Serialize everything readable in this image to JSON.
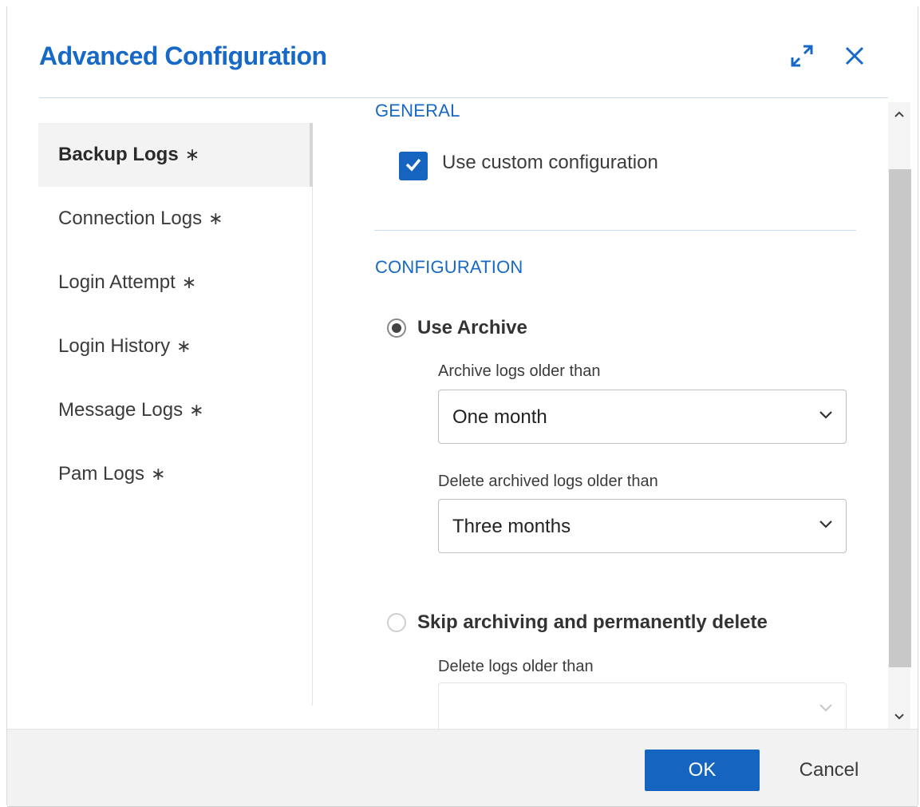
{
  "dialog": {
    "title": "Advanced Configuration",
    "icons": {
      "expand": "expand-icon",
      "close": "close-icon"
    },
    "accent_color": "#1769c7"
  },
  "sidebar": {
    "items": [
      {
        "label": "Backup Logs",
        "marker": "∗",
        "active": true
      },
      {
        "label": "Connection Logs",
        "marker": "∗",
        "active": false
      },
      {
        "label": "Login Attempt",
        "marker": "∗",
        "active": false
      },
      {
        "label": "Login History",
        "marker": "∗",
        "active": false
      },
      {
        "label": "Message Logs",
        "marker": "∗",
        "active": false
      },
      {
        "label": "Pam Logs",
        "marker": "∗",
        "active": false
      }
    ]
  },
  "general": {
    "section_title": "GENERAL",
    "custom_config_label": "Use custom configuration",
    "custom_config_checked": true
  },
  "configuration": {
    "section_title": "CONFIGURATION",
    "use_archive": {
      "label": "Use Archive",
      "selected": true,
      "archive_label": "Archive logs older than",
      "archive_value": "One month",
      "delete_archived_label": "Delete archived logs older than",
      "delete_archived_value": "Three months"
    },
    "skip_archiving": {
      "label": "Skip archiving and permanently delete",
      "selected": false,
      "delete_label": "Delete logs older than",
      "delete_value": ""
    }
  },
  "footer": {
    "ok_label": "OK",
    "cancel_label": "Cancel",
    "ok_color": "#1565c0"
  }
}
